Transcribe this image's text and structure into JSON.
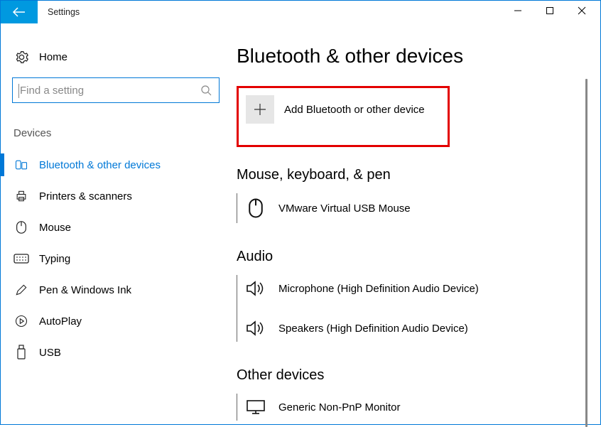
{
  "window": {
    "title": "Settings"
  },
  "sidebar": {
    "home": "Home",
    "search_placeholder": "Find a setting",
    "section_header": "Devices",
    "items": [
      {
        "label": "Bluetooth & other devices",
        "selected": true
      },
      {
        "label": "Printers & scanners"
      },
      {
        "label": "Mouse"
      },
      {
        "label": "Typing"
      },
      {
        "label": "Pen & Windows Ink"
      },
      {
        "label": "AutoPlay"
      },
      {
        "label": "USB"
      }
    ]
  },
  "main": {
    "page_title": "Bluetooth & other devices",
    "add_button_label": "Add Bluetooth or other device",
    "groups": {
      "mouse": {
        "heading": "Mouse, keyboard, & pen",
        "items": [
          {
            "label": "VMware Virtual USB Mouse"
          }
        ]
      },
      "audio": {
        "heading": "Audio",
        "items": [
          {
            "label": "Microphone (High Definition Audio Device)"
          },
          {
            "label": "Speakers (High Definition Audio Device)"
          }
        ]
      },
      "other": {
        "heading": "Other devices",
        "items": [
          {
            "label": "Generic Non-PnP Monitor"
          }
        ]
      }
    }
  }
}
